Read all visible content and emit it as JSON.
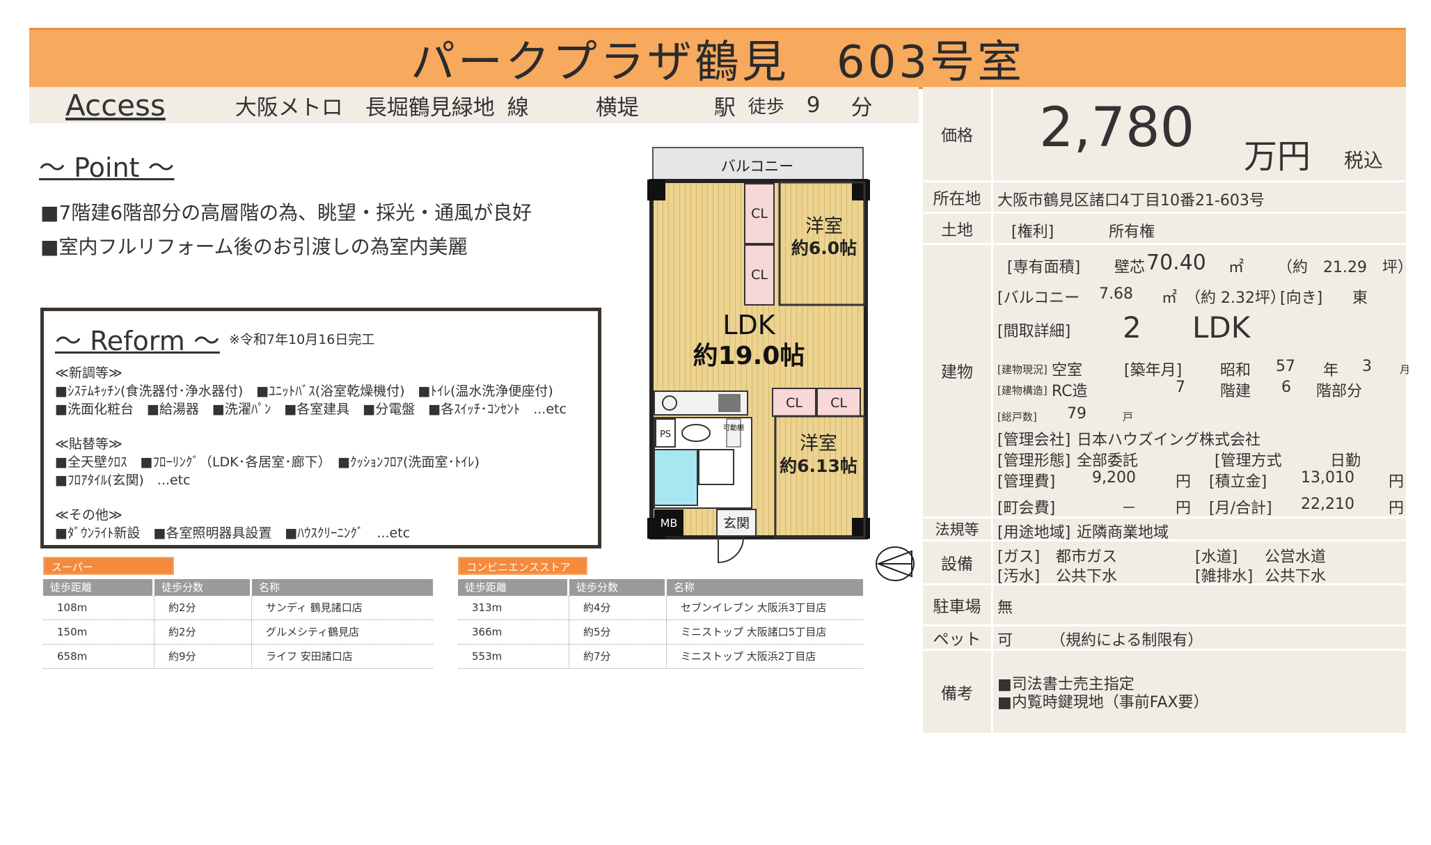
{
  "title": "パークプラザ鶴見　603号室",
  "access": {
    "label": "Access",
    "railway": "大阪メトロ",
    "line": "長堀鶴見緑地",
    "line_suffix": "線",
    "station": "横堤",
    "station_suffix": "駅",
    "walk_label": "徒歩",
    "walk_min": "9",
    "walk_unit": "分"
  },
  "point": {
    "title": "～ Point ～",
    "lines": [
      "■7階建6階部分の高層階の為、眺望・採光・通風が良好",
      "■室内フルリフォーム後のお引渡しの為室内美麗"
    ]
  },
  "reform": {
    "title": "～ Reform ～",
    "note": "※令和7年10月16日完工",
    "sec1_title": "≪新調等≫",
    "sec1_line1": "■ｼｽﾃﾑｷｯﾁﾝ(食洗器付･浄水器付)　■ﾕﾆｯﾄﾊﾞｽ(浴室乾燥機付)　■ﾄｲﾚ(温水洗浄便座付)",
    "sec1_line2": "■洗面化粧台　■給湯器　■洗濯ﾊﾟﾝ　■各室建具　■分電盤　■各ｽｲｯﾁ･ｺﾝｾﾝﾄ　...etc",
    "sec2_title": "≪貼替等≫",
    "sec2_line1": "■全天壁ｸﾛｽ　■ﾌﾛｰﾘﾝｸﾞ（LDK･各居室･廊下）　■ｸｯｼｮﾝﾌﾛｱ(洗面室･ﾄｲﾚ)",
    "sec2_line2": "■ﾌﾛｱﾀｲﾙ(玄関)　...etc",
    "sec3_title": "≪その他≫",
    "sec3_line1": "■ﾀﾞｳﾝﾗｲﾄ新設　■各室照明器具設置　■ﾊｳｽｸﾘｰﾆﾝｸﾞ　...etc"
  },
  "floorplan": {
    "balcony": "バルコニー",
    "cl": "CL",
    "room1_name": "洋室",
    "room1_size": "約6.0帖",
    "ldk_name": "LDK",
    "ldk_size": "約19.0帖",
    "room2_name": "洋室",
    "room2_size": "約6.13帖",
    "ps": "PS",
    "mb": "MB",
    "entrance": "玄関",
    "movable_shelf": "可動棚"
  },
  "supermarket": {
    "tag": "スーパー",
    "headers": [
      "徒歩距離",
      "徒歩分数",
      "名称"
    ],
    "rows": [
      {
        "dist": "108m",
        "min": "約2分",
        "name": "サンディ 鶴見諸口店"
      },
      {
        "dist": "150m",
        "min": "約2分",
        "name": "グルメシティ鶴見店"
      },
      {
        "dist": "658m",
        "min": "約9分",
        "name": "ライフ 安田諸口店"
      }
    ]
  },
  "convenience": {
    "tag": "コンビニエンスストア",
    "headers": [
      "徒歩距離",
      "徒歩分数",
      "名称"
    ],
    "rows": [
      {
        "dist": "313m",
        "min": "約4分",
        "name": "セブンイレブン 大阪浜3丁目店"
      },
      {
        "dist": "366m",
        "min": "約5分",
        "name": "ミニストップ 大阪諸口5丁目店"
      },
      {
        "dist": "553m",
        "min": "約7分",
        "name": "ミニストップ 大阪浜2丁目店"
      }
    ]
  },
  "info": {
    "price_label": "価格",
    "price": "2,780",
    "price_unit": "万円",
    "tax": "税込",
    "address_label": "所在地",
    "address": "大阪市鶴見区諸口4丁目10番21-603号",
    "land_label": "土地",
    "land_right": "[権利]",
    "land_value": "所有権",
    "building_label": "建物",
    "area_label": "[専有面積]",
    "area_wall": "壁芯",
    "area": "70.40",
    "area_unit": "㎡",
    "area_tsubo": "（約　21.29　坪）",
    "balcony_label": "[バルコニー",
    "balcony_area": "7.68",
    "balcony_unit": "㎡",
    "balcony_tsubo": "（約 2.32坪）",
    "direction_label": "[向き]",
    "direction": "東",
    "layout_label": "[間取詳細]",
    "layout_num": "2",
    "layout_type": "LDK",
    "status_label": "[建物現況]",
    "status": "空室",
    "built_label": "[築年月]",
    "era": "昭和",
    "built_year": "57",
    "year_unit": "年",
    "built_month": "3",
    "month_unit": "月",
    "structure_label": "[建物構造]",
    "structure": "RC造",
    "floors": "7",
    "floors_unit": "階建",
    "floor": "6",
    "floor_unit": "階部分",
    "units_label": "[総戸数]",
    "units": "79",
    "units_unit": "戸",
    "mgmt_co_label": "[管理会社]",
    "mgmt_co": "日本ハウズイング株式会社",
    "mgmt_form_label": "[管理形態]",
    "mgmt_form": "全部委託",
    "mgmt_method_label": "[管理方式",
    "mgmt_method": "日勤",
    "mgmt_fee_label": "[管理費]",
    "mgmt_fee": "9,200",
    "yen": "円",
    "reserve_label": "[積立金]",
    "reserve": "13,010",
    "town_fee_label": "[町会費]",
    "town_fee": "－",
    "monthly_label": "[月/合計]",
    "monthly": "22,210",
    "law_label": "法規等",
    "zoning_label": "[用途地域]",
    "zoning": "近隣商業地域",
    "equip_label": "設備",
    "gas_label": "[ガス]",
    "gas": "都市ガス",
    "water_label": "[水道]",
    "water": "公営水道",
    "sewage_label": "[汚水]",
    "sewage": "公共下水",
    "drain_label": "[雑排水]",
    "drain": "公共下水",
    "parking_label": "駐車場",
    "parking": "無",
    "pet_label": "ペット",
    "pet": "可",
    "pet_note": "（規約による制限有）",
    "remarks_label": "備考",
    "remarks1": "■司法書士売主指定",
    "remarks2": "■内覧時鍵現地（事前FAX要）"
  }
}
